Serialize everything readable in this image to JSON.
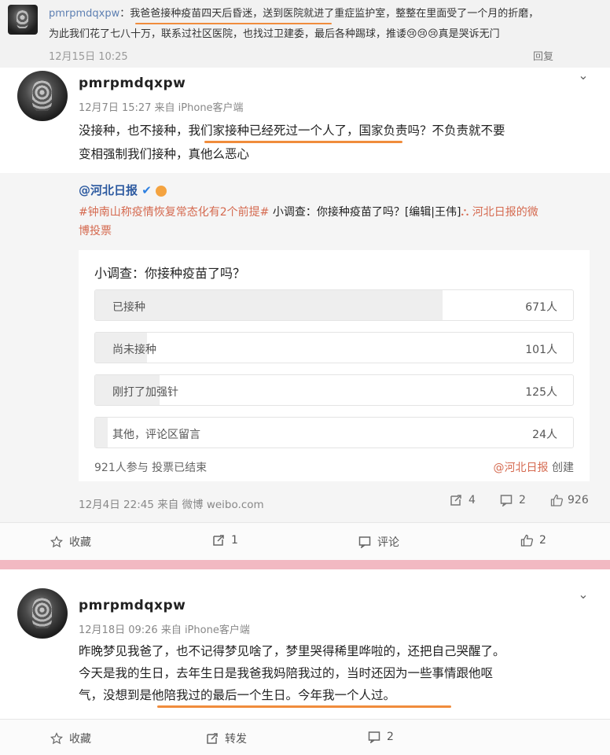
{
  "top": {
    "username": "pmrpmdqxpw",
    "colon": "：",
    "line1": "我爸爸接种疫苗四天后昏迷，送到医院就进了重症监护室，整整在里面受了一个月的折磨，",
    "line2": "为此我们花了七八十万，联系过社区医院，也找过卫建委，最后各种踢球，推诿😢😢😢真是哭诉无门",
    "timestamp": "12月15日 10:25",
    "action": "回复"
  },
  "post1": {
    "username": "pmrpmdqxpw",
    "meta": "12月7日 15:27 来自 iPhone客户端",
    "line1": "没接种，也不接种，我们家接种已经死过一个人了，国家负责吗？不负责就不要",
    "line2": "变相强制我们接种，真他么恶心",
    "embed": {
      "source": "@河北日报",
      "line1_tag": "#钟南山称疫情恢复常态化有2个前提#",
      "line1_text": " 小调查：你接种疫苗了吗？[编辑|王伟]",
      "line1_link": " 河北日报的微",
      "line2_link": "博投票",
      "poll": {
        "title": "小调查：你接种疫苗了吗？",
        "options": [
          {
            "label": "已接种",
            "count": "671人",
            "share": 0.727
          },
          {
            "label": "尚未接种",
            "count": "101人",
            "share": 0.109
          },
          {
            "label": "刚打了加强针",
            "count": "125人",
            "share": 0.135
          },
          {
            "label": "其他，评论区留言",
            "count": "24人",
            "share": 0.026
          }
        ],
        "footer": "921人参与 投票已结束",
        "creator_name": "@河北日报",
        "creator_suffix": " 创建"
      },
      "meta": "12月4日 22:45 来自 微博 weibo.com",
      "reposts": "4",
      "comments": "2",
      "likes": "926"
    },
    "actions": {
      "favorite": "收藏",
      "repost": "1",
      "comment": "评论",
      "like": "2"
    }
  },
  "post2": {
    "username": "pmrpmdqxpw",
    "meta": "12月18日 09:26 来自 iPhone客户端",
    "line1": "昨晚梦见我爸了，也不记得梦见啥了，梦里哭得稀里哗啦的，还把自己哭醒了。",
    "line2": "今天是我的生日，去年生日是我爸我妈陪我过的，当时还因为一些事情跟他呕",
    "line3": "气，没想到是他陪我过的最后一个生日。今年我一个人过。",
    "actions": {
      "favorite": "收藏",
      "repost": "转发",
      "comment": "2"
    }
  },
  "colors": {
    "accent_underline": "#f08c3c",
    "link": "#2d5aa0",
    "tag": "#d56a50",
    "divider": "#f2b9c2"
  }
}
